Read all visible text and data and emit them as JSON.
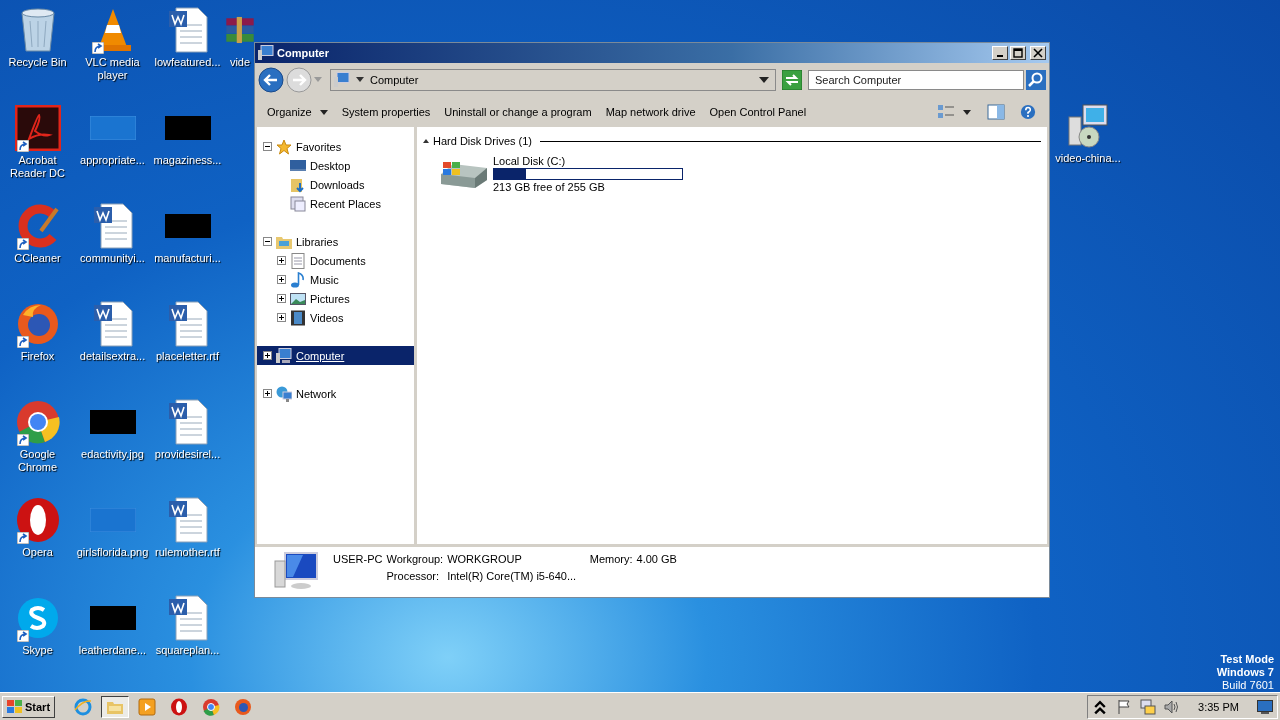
{
  "desktop": {
    "icons": [
      {
        "label": "Recycle Bin",
        "kind": "recycle",
        "shortcut": false
      },
      {
        "label": "Acrobat Reader DC",
        "kind": "acrobat",
        "shortcut": true
      },
      {
        "label": "CCleaner",
        "kind": "ccleaner",
        "shortcut": true
      },
      {
        "label": "Firefox",
        "kind": "firefox",
        "shortcut": true
      },
      {
        "label": "Google Chrome",
        "kind": "chrome",
        "shortcut": true
      },
      {
        "label": "Opera",
        "kind": "opera",
        "shortcut": true
      },
      {
        "label": "Skype",
        "kind": "skype",
        "shortcut": true
      },
      {
        "label": "VLC media player",
        "kind": "vlc",
        "shortcut": true
      },
      {
        "label": "appropriate...",
        "kind": "blank",
        "shortcut": false
      },
      {
        "label": "communityi...",
        "kind": "word",
        "shortcut": false
      },
      {
        "label": "detailsextra...",
        "kind": "word",
        "shortcut": false
      },
      {
        "label": "edactivity.jpg",
        "kind": "black",
        "shortcut": false
      },
      {
        "label": "girlsflorida.png",
        "kind": "blank",
        "shortcut": false
      },
      {
        "label": "leatherdane...",
        "kind": "black",
        "shortcut": false
      },
      {
        "label": "lowfeatured...",
        "kind": "word",
        "shortcut": false
      },
      {
        "label": "magaziness...",
        "kind": "black",
        "shortcut": false
      },
      {
        "label": "manufacturi...",
        "kind": "black",
        "shortcut": false
      },
      {
        "label": "placeletter.rtf",
        "kind": "word",
        "shortcut": false
      },
      {
        "label": "providesirel...",
        "kind": "word",
        "shortcut": false
      },
      {
        "label": "rulemother.rtf",
        "kind": "word",
        "shortcut": false
      },
      {
        "label": "squareplan...",
        "kind": "word",
        "shortcut": false
      },
      {
        "label": "vide",
        "kind": "archive",
        "shortcut": false
      }
    ],
    "extra_icon": {
      "label": "video-china...",
      "kind": "installer"
    },
    "os_notice": [
      "Test Mode",
      "Windows 7",
      "Build 7601"
    ]
  },
  "window": {
    "title": "Computer",
    "address": {
      "path": "Computer"
    },
    "search": {
      "placeholder": "Search Computer"
    },
    "toolbar": [
      "Organize",
      "System properties",
      "Uninstall or change a program",
      "Map network drive",
      "Open Control Panel"
    ],
    "nav": [
      {
        "label": "Favorites",
        "kind": "favorites",
        "expanded": true,
        "selected": false,
        "children": [
          {
            "label": "Desktop",
            "kind": "desktop",
            "selected": false
          },
          {
            "label": "Downloads",
            "kind": "downloads",
            "selected": false
          },
          {
            "label": "Recent Places",
            "kind": "recent",
            "selected": false
          }
        ]
      },
      {
        "label": "Libraries",
        "kind": "libraries",
        "expanded": true,
        "selected": false,
        "children": [
          {
            "label": "Documents",
            "kind": "documents",
            "expanded": false,
            "selected": false
          },
          {
            "label": "Music",
            "kind": "music",
            "expanded": false,
            "selected": false
          },
          {
            "label": "Pictures",
            "kind": "pictures",
            "expanded": false,
            "selected": false
          },
          {
            "label": "Videos",
            "kind": "videos",
            "expanded": false,
            "selected": false
          }
        ]
      },
      {
        "label": "Computer",
        "kind": "computer",
        "expanded": false,
        "selected": true
      },
      {
        "label": "Network",
        "kind": "network",
        "expanded": false,
        "selected": false
      }
    ],
    "group": {
      "title": "Hard Disk Drives (1)",
      "expanded": true
    },
    "drives": [
      {
        "name": "Local Disk (C:)",
        "level": 0.17,
        "space": "213 GB free of 255 GB"
      }
    ],
    "details": {
      "name": "USER-PC",
      "workgroup_label": "Workgroup:",
      "workgroup": "WORKGROUP",
      "memory_label": "Memory:",
      "memory": "4.00 GB",
      "processor_label": "Processor:",
      "processor": "Intel(R) Core(TM) i5-640..."
    }
  },
  "taskbar": {
    "start": "Start",
    "apps": [
      {
        "kind": "ie",
        "selected": false
      },
      {
        "kind": "explorer",
        "selected": true
      },
      {
        "kind": "media",
        "selected": false
      },
      {
        "kind": "opera",
        "selected": false
      },
      {
        "kind": "chrome",
        "selected": false
      },
      {
        "kind": "firefox",
        "selected": false
      }
    ],
    "clock": "3:35 PM"
  }
}
